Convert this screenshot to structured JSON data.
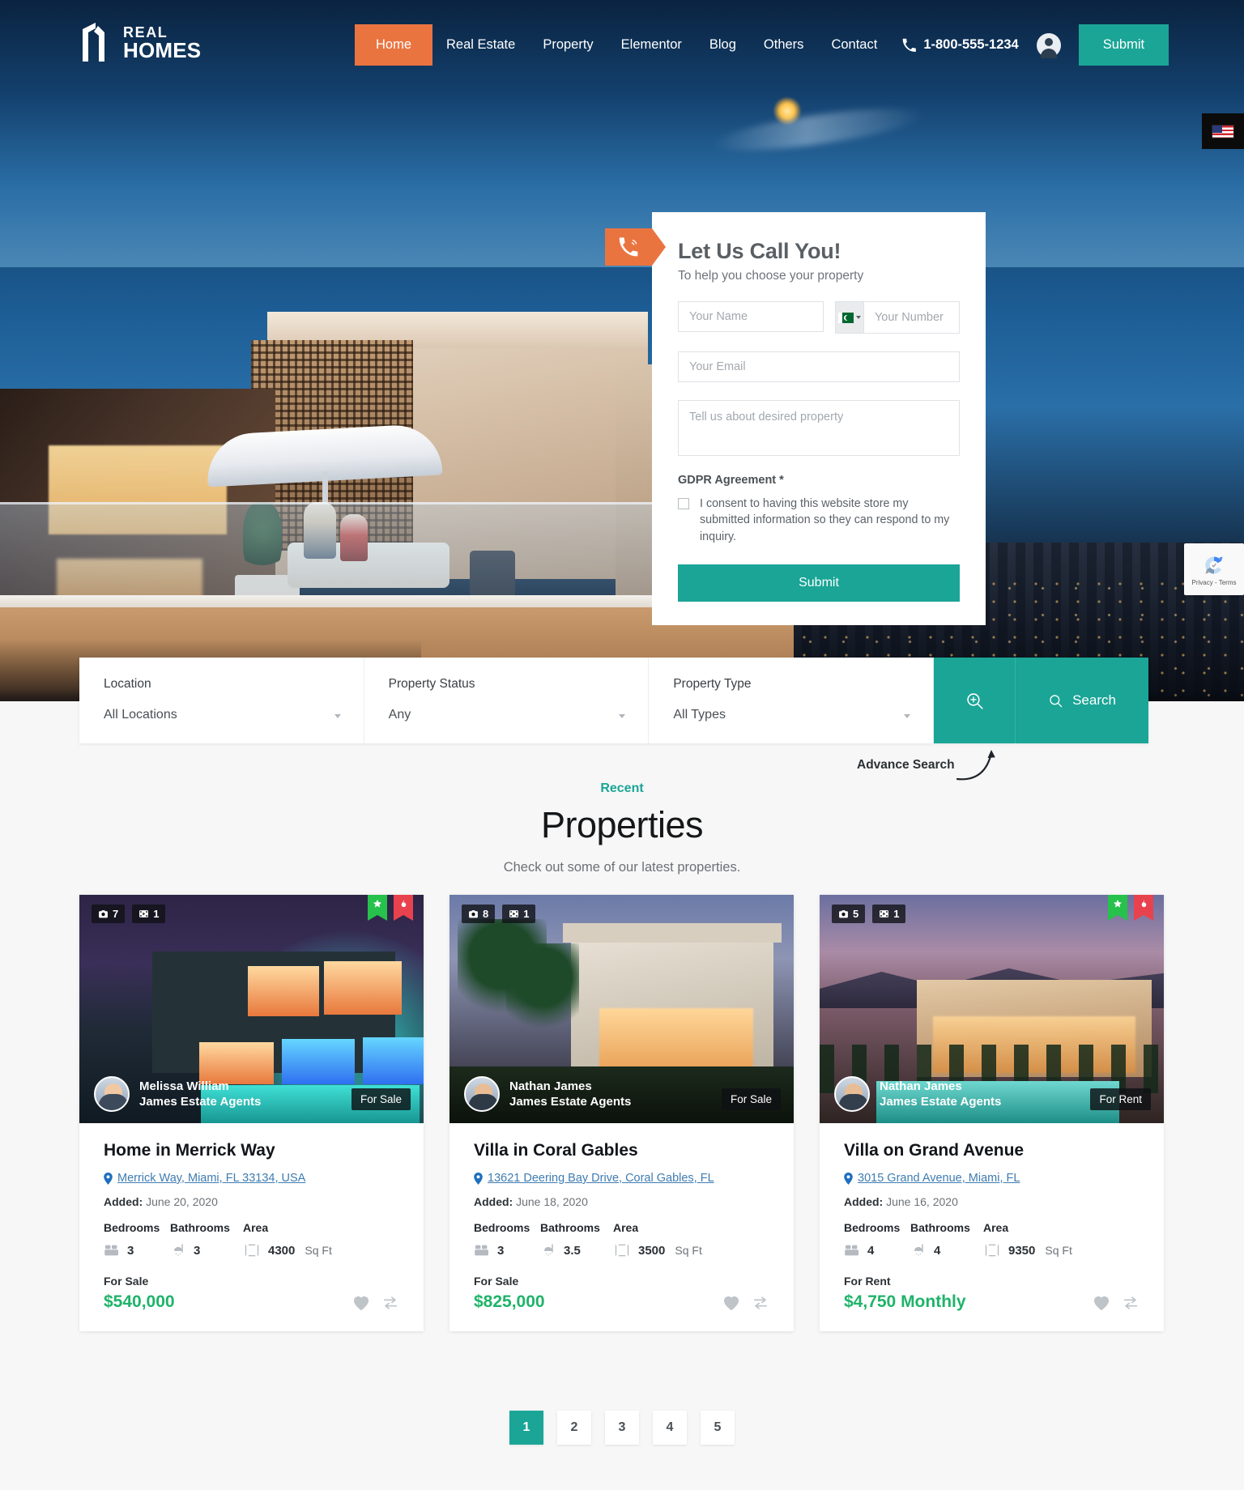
{
  "header": {
    "logo": {
      "line1": "REAL",
      "line2": "HOMES",
      "icon": "house-logo-icon"
    },
    "nav": [
      {
        "label": "Home",
        "active": true
      },
      {
        "label": "Real Estate",
        "active": false
      },
      {
        "label": "Property",
        "active": false
      },
      {
        "label": "Elementor",
        "active": false
      },
      {
        "label": "Blog",
        "active": false
      },
      {
        "label": "Others",
        "active": false
      },
      {
        "label": "Contact",
        "active": false
      }
    ],
    "phone": "1-800-555-1234",
    "phone_icon": "phone-icon",
    "account_icon": "user-account-icon",
    "submit_label": "Submit"
  },
  "language_switch": {
    "flag": "us-flag-icon"
  },
  "recaptcha": {
    "label": "Privacy - Terms",
    "icon": "recaptcha-icon"
  },
  "callback_form": {
    "tag_icon": "phone-ring-icon",
    "title": "Let Us Call You!",
    "subtitle": "To help you choose your property",
    "name_placeholder": "Your Name",
    "number_placeholder": "Your Number",
    "country_flag": "pk-flag-icon",
    "email_placeholder": "Your Email",
    "message_placeholder": "Tell us about desired property",
    "gdpr_title": "GDPR Agreement *",
    "gdpr_text": "I consent to having this website store my submitted information so they can respond to my inquiry.",
    "submit_label": "Submit"
  },
  "search_bar": {
    "fields": [
      {
        "label": "Location",
        "value": "All Locations"
      },
      {
        "label": "Property Status",
        "value": "Any"
      },
      {
        "label": "Property Type",
        "value": "All Types"
      }
    ],
    "advance_icon": "magnify-plus-icon",
    "search_icon": "search-icon",
    "search_label": "Search",
    "annotation": "Advance Search"
  },
  "section": {
    "kicker": "Recent",
    "title": "Properties",
    "subtitle": "Check out some of our latest properties."
  },
  "properties": [
    {
      "photos": "7",
      "videos": "1",
      "ribbons": [
        "featured-star",
        "hot-flame"
      ],
      "agent_name": "Melissa William",
      "agent_company": "James Estate Agents",
      "status_pill": "For Sale",
      "title": "Home in Merrick Way",
      "address": "Merrick Way, Miami, FL 33134, USA",
      "added_label": "Added:",
      "added_date": "June 20, 2020",
      "meta_labels": [
        "Bedrooms",
        "Bathrooms",
        "Area"
      ],
      "bedrooms": "3",
      "bathrooms": "3",
      "area": "4300",
      "area_unit": "Sq Ft",
      "foot_status": "For Sale",
      "price": "$540,000"
    },
    {
      "photos": "8",
      "videos": "1",
      "ribbons": [],
      "agent_name": "Nathan James",
      "agent_company": "James Estate Agents",
      "status_pill": "For Sale",
      "title": "Villa in Coral Gables",
      "address": "13621 Deering Bay Drive, Coral Gables, FL",
      "added_label": "Added:",
      "added_date": "June 18, 2020",
      "meta_labels": [
        "Bedrooms",
        "Bathrooms",
        "Area"
      ],
      "bedrooms": "3",
      "bathrooms": "3.5",
      "area": "3500",
      "area_unit": "Sq Ft",
      "foot_status": "For Sale",
      "price": "$825,000"
    },
    {
      "photos": "5",
      "videos": "1",
      "ribbons": [
        "featured-star",
        "hot-flame"
      ],
      "agent_name": "Nathan James",
      "agent_company": "James Estate Agents",
      "status_pill": "For Rent",
      "title": "Villa on Grand Avenue",
      "address": "3015 Grand Avenue, Miami, FL",
      "added_label": "Added:",
      "added_date": "June 16, 2020",
      "meta_labels": [
        "Bedrooms",
        "Bathrooms",
        "Area"
      ],
      "bedrooms": "4",
      "bathrooms": "4",
      "area": "9350",
      "area_unit": "Sq Ft",
      "foot_status": "For Rent",
      "price": "$4,750 Monthly"
    }
  ],
  "pagination": {
    "pages": [
      "1",
      "2",
      "3",
      "4",
      "5"
    ],
    "current": "1"
  },
  "colors": {
    "accent_teal": "#1aa596",
    "accent_orange": "#ea7440",
    "price_green": "#1fb36a",
    "link_blue": "#3e7cb1"
  }
}
